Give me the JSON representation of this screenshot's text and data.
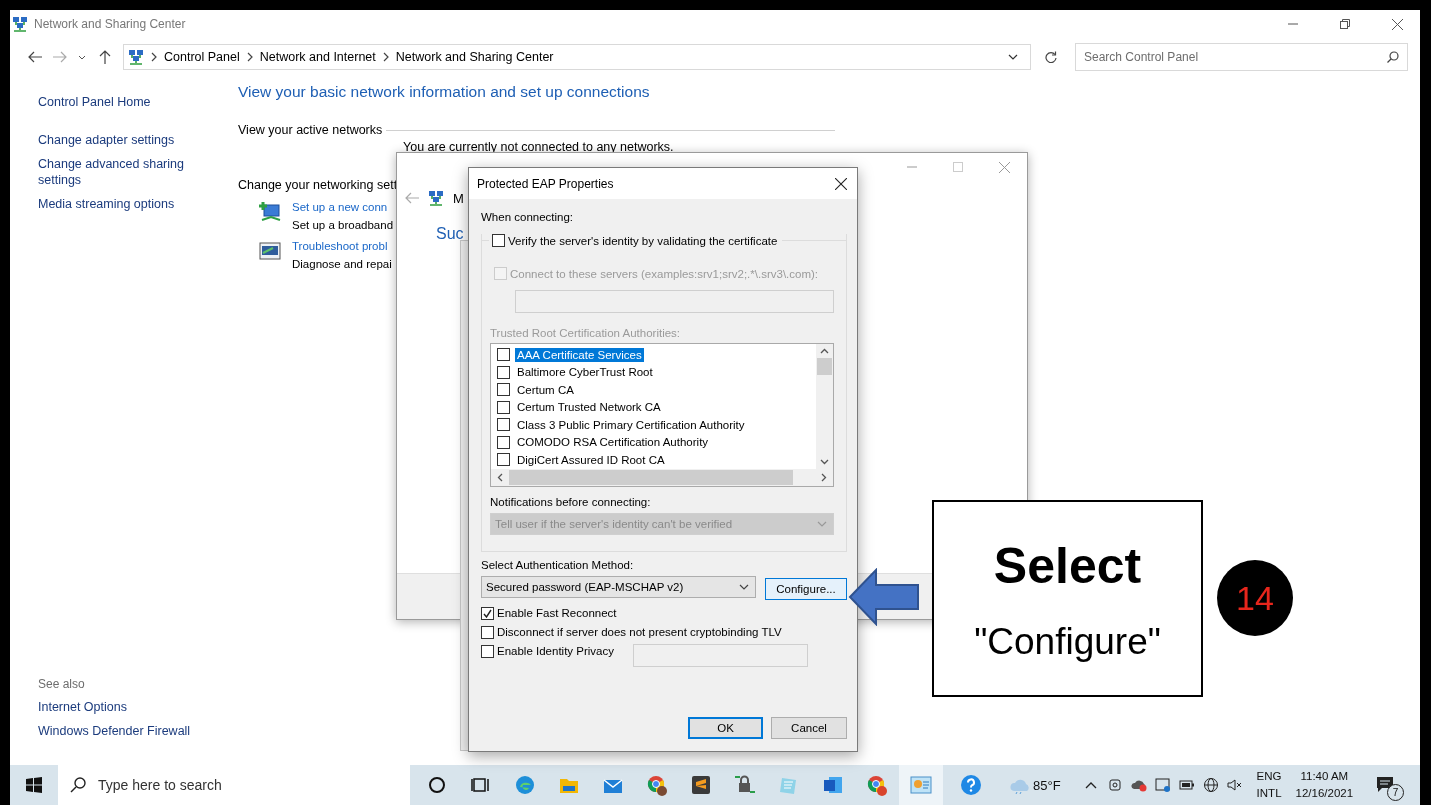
{
  "window": {
    "title": "Network and Sharing Center"
  },
  "address": {
    "breadcrumbs": [
      "Control Panel",
      "Network and Internet",
      "Network and Sharing Center"
    ],
    "search_placeholder": "Search Control Panel"
  },
  "sidebar": {
    "items": [
      "Control Panel Home",
      "Change adapter settings",
      "Change advanced sharing settings",
      "Media streaming options"
    ],
    "see_also_title": "See also",
    "see_also": [
      "Internet Options",
      "Windows Defender Firewall"
    ]
  },
  "main": {
    "heading": "View your basic network information and set up connections",
    "active_networks_label": "View your active networks",
    "status": "You are currently not connected to any networks.",
    "change_label": "Change your networking sett",
    "tasks": [
      {
        "link": "Set up a new conn",
        "description": "Set up a broadband"
      },
      {
        "link": "Troubleshoot probl",
        "description": "Diagnose and repai"
      }
    ]
  },
  "back_dialog": {
    "title_fragment": "M",
    "heading_fragment": "Suc"
  },
  "eap_dialog": {
    "title": "Protected EAP Properties",
    "when_connecting": "When connecting:",
    "verify": {
      "label": "Verify the server's identity by validating the certificate",
      "checked": false
    },
    "connect_servers": {
      "label": "Connect to these servers (examples:srv1;srv2;.*\\.srv3\\.com):",
      "checked": false,
      "disabled": true
    },
    "trusted_root_label": "Trusted Root Certification Authorities:",
    "certificates": [
      {
        "name": "AAA Certificate Services",
        "checked": false,
        "selected": true
      },
      {
        "name": "Baltimore CyberTrust Root",
        "checked": false,
        "selected": false
      },
      {
        "name": "Certum CA",
        "checked": false,
        "selected": false
      },
      {
        "name": "Certum Trusted Network CA",
        "checked": false,
        "selected": false
      },
      {
        "name": "Class 3 Public Primary Certification Authority",
        "checked": false,
        "selected": false
      },
      {
        "name": "COMODO RSA Certification Authority",
        "checked": false,
        "selected": false
      },
      {
        "name": "DigiCert Assured ID Root CA",
        "checked": false,
        "selected": false
      }
    ],
    "notifications_label": "Notifications before connecting:",
    "notifications": {
      "value": "Tell user if the server's identity can't be verified",
      "disabled": true
    },
    "auth_method_label": "Select Authentication Method:",
    "auth_method": "Secured password (EAP-MSCHAP v2)",
    "configure_button": "Configure...",
    "options": [
      {
        "label": "Enable Fast Reconnect",
        "checked": true
      },
      {
        "label": "Disconnect if server does not present cryptobinding TLV",
        "checked": false
      },
      {
        "label": "Enable Identity Privacy",
        "checked": false
      }
    ],
    "ok_button": "OK",
    "cancel_button": "Cancel"
  },
  "callout": {
    "title": "Select",
    "subtitle": "\"Configure\"",
    "step": "14"
  },
  "taskbar": {
    "search_placeholder": "Type here to search",
    "weather": "85°F",
    "language": "ENG",
    "layout": "INTL",
    "time": "11:40 AM",
    "date": "12/16/2021",
    "notification_count": "7"
  }
}
